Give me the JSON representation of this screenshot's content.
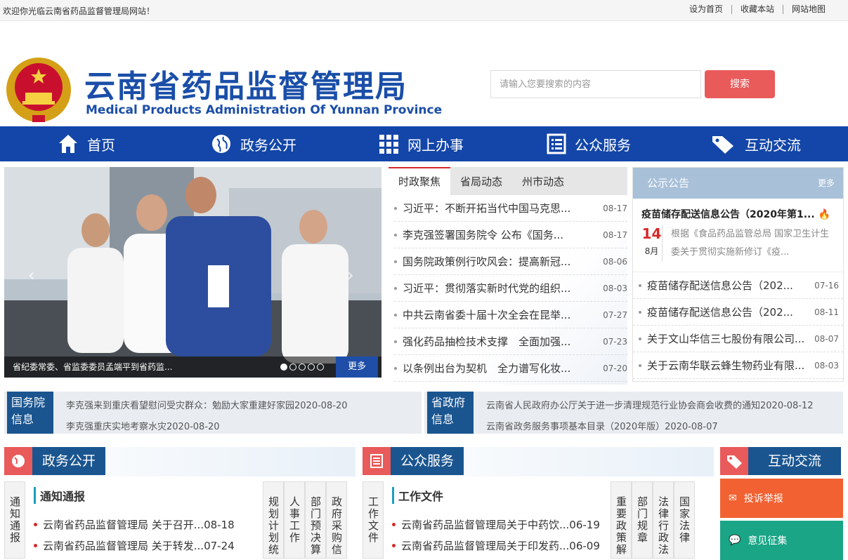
{
  "topbar": {
    "welcome": "欢迎你光临云南省药品监督管理局网站！",
    "links": [
      "设为首页",
      "收藏本站",
      "网站地图"
    ]
  },
  "header": {
    "title": "云南省药品监督管理局",
    "subtitle": "Medical Products Administration Of Yunnan Province",
    "search_placeholder": "请输入您要搜索的内容",
    "search_button": "搜索"
  },
  "nav": [
    {
      "label": "首页",
      "icon": "home-icon"
    },
    {
      "label": "政务公开",
      "icon": "globe-icon"
    },
    {
      "label": "网上办事",
      "icon": "grid-icon"
    },
    {
      "label": "公众服务",
      "icon": "list-icon"
    },
    {
      "label": "互动交流",
      "icon": "tag-icon"
    }
  ],
  "slider": {
    "caption": "省纪委常委、省监委委员孟端平到省药监...",
    "more": "更多"
  },
  "news": {
    "tabs": [
      "时政聚焦",
      "省局动态",
      "州市动态"
    ],
    "items": [
      {
        "title": "习近平：不断开拓当代中国马克思...",
        "date": "08-17"
      },
      {
        "title": "李克强签署国务院令 公布《国务...",
        "date": "08-17"
      },
      {
        "title": "国务院政策例行吹风会：提高新冠...",
        "date": "08-06"
      },
      {
        "title": "习近平：贯彻落实新时代党的组织...",
        "date": "08-03"
      },
      {
        "title": "中共云南省委十届十次全会在昆举...",
        "date": "07-27"
      },
      {
        "title": "强化药品抽检技术支撑　全面加强...",
        "date": "07-23"
      },
      {
        "title": "以条例出台为契机　全力谱写化妆...",
        "date": "07-20"
      }
    ]
  },
  "notice": {
    "title": "公示公告",
    "more": "更多",
    "top_title": "疫苗储存配送信息公告（2020年第1...",
    "day": "14",
    "month": "8月",
    "summary": "根据《食品药品监管总局 国家卫生计生委关于贯彻实施新修订《疫...",
    "items": [
      {
        "title": "疫苗储存配送信息公告（202...",
        "date": "07-16"
      },
      {
        "title": "疫苗储存配送信息公告（202...",
        "date": "08-11"
      },
      {
        "title": "关于文山华信三七股份有限公司...",
        "date": "08-07"
      },
      {
        "title": "关于云南华联云蜂生物药业有限...",
        "date": "08-03"
      }
    ]
  },
  "info_left": {
    "label": "国务院信息",
    "lines": [
      "李克强来到重庆看望慰问受灾群众：勉励大家重建好家园2020-08-20",
      "李克强重庆实地考察水灾2020-08-20"
    ]
  },
  "info_right": {
    "label": "省政府信息",
    "lines": [
      "云南省人民政府办公厅关于进一步清理规范行业协会商会收费的通知2020-08-12",
      "云南省政务服务事项基本目录（2020年版）2020-08-07"
    ]
  },
  "sec1": {
    "title": "政务公开",
    "vtab_left": "通知通报",
    "sub_title": "通知通报",
    "rows": [
      "云南省药品监督管理局 关于召开...08-18",
      "云南省药品监督管理局 关于转发...07-24"
    ],
    "vtabs_right": [
      "规划计划统",
      "人事工作",
      "部门预决算",
      "政府采购信"
    ]
  },
  "sec2": {
    "title": "公众服务",
    "vtab_left": "工作文件",
    "sub_title": "工作文件",
    "rows": [
      "云南省药品监督管理局关于中药饮...06-19",
      "云南省药品监督管理局关于印发药...06-09"
    ],
    "vtabs_right": [
      "重要政策解",
      "部门规章",
      "法律行政法",
      "国家法律"
    ]
  },
  "sec3": {
    "title": "互动交流",
    "buttons": [
      "投诉举报",
      "意见征集"
    ]
  }
}
